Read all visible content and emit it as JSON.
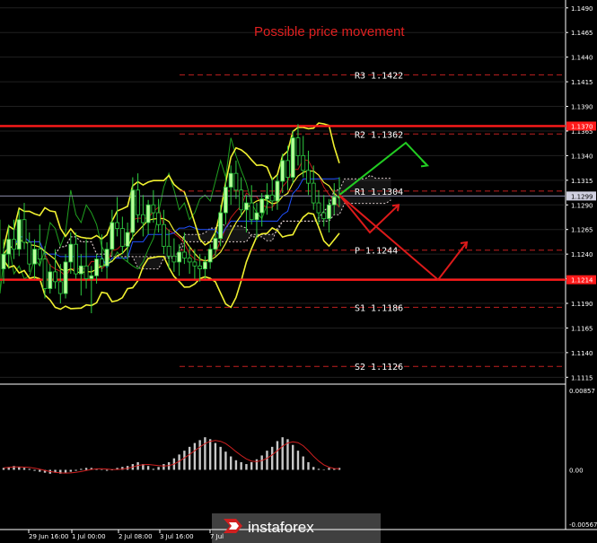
{
  "chart_data": {
    "type": "candlestick",
    "title": "Possible price movement",
    "price_axis": {
      "ylim": [
        1.1108,
        1.1498
      ],
      "tick_labels": [
        "1.1490",
        "1.1465",
        "1.1440",
        "1.1415",
        "1.1390",
        "1.1365",
        "1.1340",
        "1.1315",
        "1.1290",
        "1.1265",
        "1.1240",
        "1.1215",
        "1.1190",
        "1.1165",
        "1.1140",
        "1.1115"
      ],
      "current_price_label": "1.1299",
      "current_price": 1.1299,
      "high_marker_label": "1.1370",
      "high_marker": 1.137,
      "low_marker_label": "1.1214",
      "low_marker": 1.1214
    },
    "time_labels": [
      "29 Jun 16:00",
      "1 Jul 00:00",
      "2 Jul 08:00",
      "3 Jul 16:00",
      "7 Jul"
    ],
    "levels": [
      {
        "name": "R3",
        "value": 1.1422,
        "label": "R3 1.1422"
      },
      {
        "name": "R2",
        "value": 1.1362,
        "label": "R2 1.1362"
      },
      {
        "name": "R1",
        "value": 1.1304,
        "label": "R1 1.1304"
      },
      {
        "name": "P",
        "value": 1.1244,
        "label": "P 1.1244"
      },
      {
        "name": "S1",
        "value": 1.1186,
        "label": "S1 1.1186"
      },
      {
        "name": "S2",
        "value": 1.1126,
        "label": "S2 1.1126"
      }
    ],
    "support_resistance": [
      1.137,
      1.1214
    ],
    "candles": [
      [
        1.1225,
        1.1255,
        1.121,
        1.124
      ],
      [
        1.124,
        1.127,
        1.1225,
        1.1255
      ],
      [
        1.1255,
        1.1275,
        1.1235,
        1.1245
      ],
      [
        1.1245,
        1.1285,
        1.1238,
        1.1275
      ],
      [
        1.1275,
        1.1292,
        1.1245,
        1.1252
      ],
      [
        1.1252,
        1.1262,
        1.1222,
        1.123
      ],
      [
        1.123,
        1.1255,
        1.1215,
        1.1245
      ],
      [
        1.1245,
        1.127,
        1.1228,
        1.1235
      ],
      [
        1.1235,
        1.1248,
        1.1195,
        1.1205
      ],
      [
        1.1205,
        1.123,
        1.12,
        1.1222
      ],
      [
        1.1222,
        1.1245,
        1.1205,
        1.1212
      ],
      [
        1.1212,
        1.123,
        1.119,
        1.12
      ],
      [
        1.12,
        1.124,
        1.1195,
        1.1232
      ],
      [
        1.1232,
        1.1262,
        1.122,
        1.125
      ],
      [
        1.125,
        1.1262,
        1.1215,
        1.122
      ],
      [
        1.122,
        1.124,
        1.1198,
        1.1228
      ],
      [
        1.1228,
        1.1255,
        1.1205,
        1.1215
      ],
      [
        1.1215,
        1.1228,
        1.118,
        1.1218
      ],
      [
        1.1218,
        1.124,
        1.121,
        1.1235
      ],
      [
        1.1235,
        1.126,
        1.1222,
        1.1228
      ],
      [
        1.1228,
        1.1252,
        1.1215,
        1.1245
      ],
      [
        1.1245,
        1.1285,
        1.1238,
        1.1272
      ],
      [
        1.1272,
        1.1298,
        1.1258,
        1.1266
      ],
      [
        1.1266,
        1.1278,
        1.124,
        1.1248
      ],
      [
        1.1248,
        1.1272,
        1.1232,
        1.1262
      ],
      [
        1.1262,
        1.1318,
        1.1255,
        1.1305
      ],
      [
        1.1305,
        1.1322,
        1.1272,
        1.128
      ],
      [
        1.128,
        1.13,
        1.1258,
        1.1272
      ],
      [
        1.1272,
        1.1295,
        1.126,
        1.129
      ],
      [
        1.129,
        1.1305,
        1.1272,
        1.1282
      ],
      [
        1.1282,
        1.1296,
        1.1262,
        1.127
      ],
      [
        1.127,
        1.1285,
        1.124,
        1.1248
      ],
      [
        1.1248,
        1.1265,
        1.1225,
        1.1238
      ],
      [
        1.1238,
        1.1256,
        1.1222,
        1.1232
      ],
      [
        1.1232,
        1.125,
        1.1218,
        1.1242
      ],
      [
        1.1242,
        1.1262,
        1.123,
        1.1236
      ],
      [
        1.1236,
        1.1248,
        1.122,
        1.1232
      ],
      [
        1.1232,
        1.1245,
        1.1215,
        1.1228
      ],
      [
        1.1228,
        1.124,
        1.1212,
        1.1225
      ],
      [
        1.1225,
        1.1238,
        1.1215,
        1.1232
      ],
      [
        1.1232,
        1.125,
        1.1225,
        1.1245
      ],
      [
        1.1245,
        1.1262,
        1.1238,
        1.1256
      ],
      [
        1.1256,
        1.129,
        1.1248,
        1.1282
      ],
      [
        1.1282,
        1.1318,
        1.127,
        1.1308
      ],
      [
        1.1308,
        1.133,
        1.129,
        1.1322
      ],
      [
        1.1322,
        1.1335,
        1.1296,
        1.1305
      ],
      [
        1.1305,
        1.1318,
        1.1278,
        1.1285
      ],
      [
        1.1285,
        1.13,
        1.1262,
        1.1292
      ],
      [
        1.1292,
        1.131,
        1.127,
        1.1275
      ],
      [
        1.1275,
        1.1292,
        1.1255,
        1.1282
      ],
      [
        1.1282,
        1.1302,
        1.1268,
        1.1296
      ],
      [
        1.1296,
        1.1312,
        1.128,
        1.13
      ],
      [
        1.13,
        1.1318,
        1.1284,
        1.1294
      ],
      [
        1.1294,
        1.132,
        1.1285,
        1.1314
      ],
      [
        1.1314,
        1.1342,
        1.1302,
        1.1335
      ],
      [
        1.1335,
        1.135,
        1.1305,
        1.1318
      ],
      [
        1.1318,
        1.1365,
        1.1312,
        1.1358
      ],
      [
        1.1358,
        1.1372,
        1.133,
        1.134
      ],
      [
        1.134,
        1.136,
        1.1318,
        1.1325
      ],
      [
        1.1325,
        1.1345,
        1.13,
        1.1312
      ],
      [
        1.1312,
        1.133,
        1.1285,
        1.1292
      ],
      [
        1.1292,
        1.1305,
        1.127,
        1.1282
      ],
      [
        1.1282,
        1.13,
        1.1268,
        1.1276
      ],
      [
        1.1276,
        1.1296,
        1.1262,
        1.129
      ],
      [
        1.129,
        1.1312,
        1.128,
        1.1298
      ],
      [
        1.1298,
        1.1318,
        1.1288,
        1.1299
      ]
    ],
    "oscillator": {
      "ylim": [
        -0.00567,
        0.00857
      ],
      "tick_labels": [
        "0.00857",
        "0.00",
        "-0.00567"
      ],
      "values": [
        0.0002,
        0.0003,
        0.0004,
        0.0003,
        0.0002,
        0.0001,
        -0.0001,
        -0.0002,
        -0.0003,
        -0.0004,
        -0.0003,
        -0.0004,
        -0.0003,
        -0.0002,
        -0.0001,
        0.0001,
        0.0002,
        0.0002,
        0.0001,
        0.0,
        -0.0001,
        0.0,
        0.0002,
        0.0003,
        0.0004,
        0.0006,
        0.0008,
        0.0006,
        0.0004,
        0.0001,
        0.0003,
        0.0006,
        0.0008,
        0.0012,
        0.0016,
        0.002,
        0.0024,
        0.0028,
        0.0031,
        0.0034,
        0.0032,
        0.0028,
        0.0024,
        0.0019,
        0.0014,
        0.001,
        0.0008,
        0.0006,
        0.0008,
        0.0011,
        0.0015,
        0.002,
        0.0024,
        0.003,
        0.0034,
        0.0032,
        0.0026,
        0.002,
        0.0014,
        0.0008,
        0.0003,
        0.0001,
        0.0,
        0.0002,
        0.0001,
        0.0002
      ]
    }
  },
  "logo": {
    "text": "instaforex"
  }
}
